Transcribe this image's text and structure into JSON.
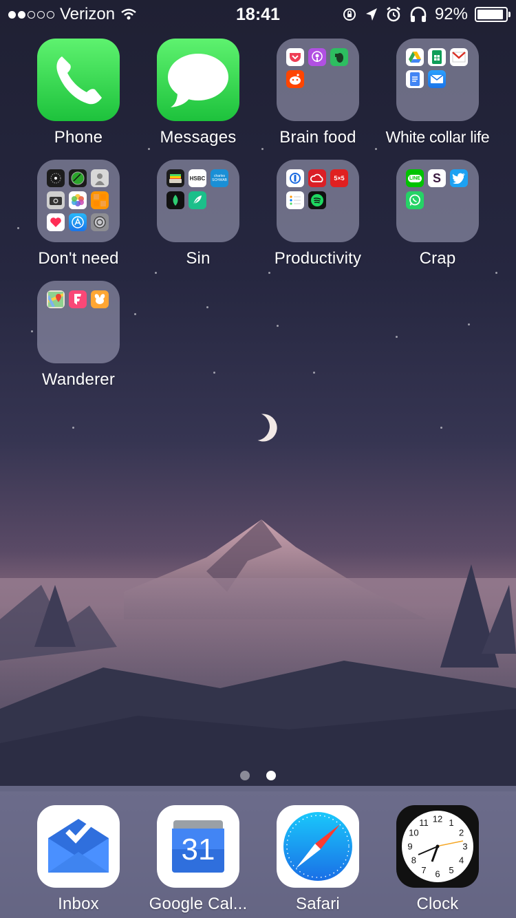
{
  "status_bar": {
    "carrier": "Verizon",
    "signal_bars_filled": 2,
    "signal_bars_total": 5,
    "time": "18:41",
    "battery_percent": "92%",
    "battery_level": 0.92
  },
  "home_apps": [
    {
      "label": "Phone",
      "type": "app",
      "icon": "phone-icon"
    },
    {
      "label": "Messages",
      "type": "app",
      "icon": "messages-icon"
    },
    {
      "label": "Brain food",
      "type": "folder",
      "apps": [
        "pocket-icon",
        "podcasts-icon",
        "evernote-icon",
        "reddit-icon"
      ]
    },
    {
      "label": "White collar life",
      "type": "folder",
      "apps": [
        "google-drive-icon",
        "google-sheets-icon",
        "gmail-icon",
        "google-docs-icon",
        "mail-icon"
      ]
    },
    {
      "label": "Don't need",
      "type": "folder",
      "apps": [
        "watch-icon",
        "find-friends-icon",
        "contacts-icon",
        "camera-icon",
        "photos-icon",
        "calculator-icon",
        "health-icon",
        "app-store-icon",
        "settings-icon"
      ]
    },
    {
      "label": "Sin",
      "type": "folder",
      "apps": [
        "wallet-icon",
        "hsbc-icon",
        "charles-schwab-icon",
        "mint-icon",
        "feather-icon"
      ]
    },
    {
      "label": "Productivity",
      "type": "folder",
      "apps": [
        "1password-icon",
        "creative-cloud-icon",
        "5x5-icon",
        "reminders-icon",
        "spotify-icon"
      ]
    },
    {
      "label": "Crap",
      "type": "folder",
      "apps": [
        "line-icon",
        "slack-icon",
        "twitter-icon",
        "whatsapp-icon"
      ]
    },
    {
      "label": "Wanderer",
      "type": "folder",
      "apps": [
        "google-maps-icon",
        "foursquare-icon",
        "swarm-icon"
      ]
    }
  ],
  "mini_texts": {
    "hsbc": "HSBC",
    "schwab": "charles SCHWAB",
    "line": "LINE",
    "fivebyfive": "5×5",
    "slack": "S"
  },
  "page_dots": {
    "count": 2,
    "active": 1
  },
  "dock": [
    {
      "label": "Inbox",
      "icon": "inbox-icon"
    },
    {
      "label": "Google Cal...",
      "icon": "google-calendar-icon",
      "day": "31"
    },
    {
      "label": "Safari",
      "icon": "safari-icon"
    },
    {
      "label": "Clock",
      "icon": "clock-icon"
    }
  ],
  "clock_numbers": [
    "12",
    "1",
    "2",
    "3",
    "4",
    "5",
    "6",
    "7",
    "8",
    "9",
    "10",
    "11"
  ],
  "colors": {
    "phone_green": "#2ed24d",
    "folder_bg": "#aaaac3",
    "dock_bg": "#9696b9"
  }
}
